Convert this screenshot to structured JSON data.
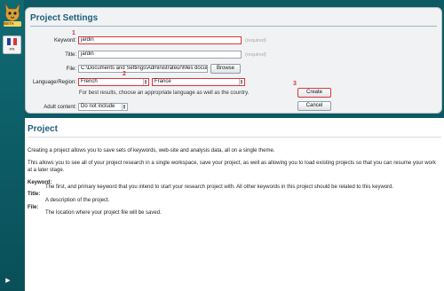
{
  "app": {
    "logo_text": "BETA",
    "locale_code": "FR"
  },
  "settings": {
    "title": "Project Settings",
    "keyword": {
      "label": "Keyword:",
      "value": "jardin",
      "hint": "(required)"
    },
    "title_field": {
      "label": "Title:",
      "value": "jardin",
      "hint": "(required)"
    },
    "file": {
      "label": "File:",
      "value": "C:\\Documents and Settings\\Administrateur\\Mes docum",
      "browse": "Browse"
    },
    "language": {
      "label": "Language/Region:",
      "language_value": "French",
      "region_value": "France"
    },
    "tip": "For best results, choose an appropriate language as well as the country.",
    "adult": {
      "label": "Adult content:",
      "value": "Do not include"
    },
    "create": "Create",
    "cancel": "Cancel",
    "annotations": {
      "one": "1",
      "two": "2",
      "three": "3"
    }
  },
  "help": {
    "title": "Project",
    "p1": "Creating a project allows you to save sets of keywords, web-site and analysis data, all on a single theme.",
    "p2": "This allows you to see all of your project research in a single workspace, save your project, as well as allowing you to load existing projects so that you can resume your work at a later stage.",
    "keyword_term": "Keyword:",
    "keyword_def": "The first, and primary keyword that you intend to start your research project with. All other keywords in this project should be related to this keyword.",
    "title_term": "Title:",
    "title_def": "A description of the project.",
    "file_term": "File:",
    "file_def": "The location where your project file will be saved."
  },
  "colors": {
    "accent": "#205f7a",
    "highlight": "#d9363e",
    "rail": "#0d5a64"
  }
}
